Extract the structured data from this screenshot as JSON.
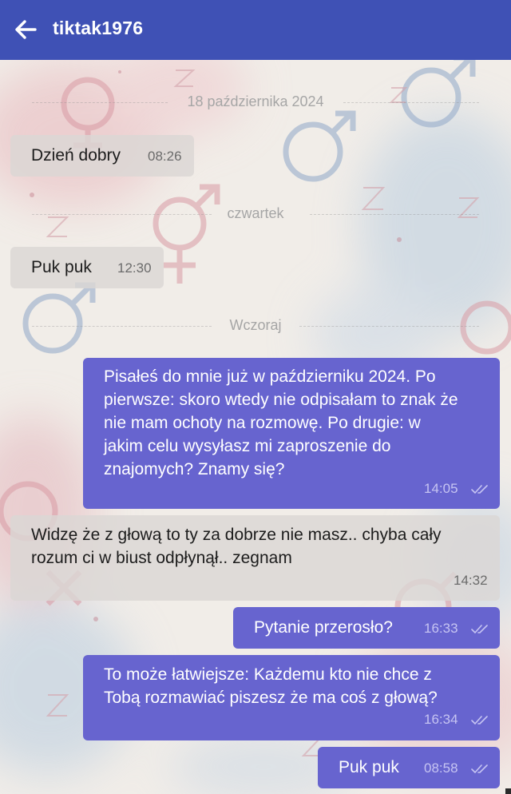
{
  "header": {
    "title": "tiktak1976",
    "back_icon": "arrow-left-icon"
  },
  "colors": {
    "header_bg": "#3f51b5",
    "outgoing_bubble": "#6764cf",
    "incoming_bubble": "#d9d6d3",
    "read_ticks": "#c6c4f2"
  },
  "separators": [
    "18 października 2024",
    "czwartek",
    "Wczoraj"
  ],
  "messages": [
    {
      "direction": "in",
      "text": "Dzień dobry",
      "time": "08:26"
    },
    {
      "direction": "in",
      "text": "Puk puk",
      "time": "12:30"
    },
    {
      "direction": "out",
      "lines": [
        "Pisałeś do mnie już w październiku 2024. Po",
        "pierwsze: skoro wtedy nie odpisałam to znak że",
        "nie mam ochoty na rozmowę. Po drugie: w",
        "jakim celu wysyłasz mi zaproszenie do",
        "znajomych? Znamy się?"
      ],
      "time": "14:05",
      "status_icon": "double-check-icon"
    },
    {
      "direction": "in",
      "lines": [
        "Widzę że z głową to ty za dobrze nie masz.. chyba cały",
        "rozum ci w biust odpłynął.. zegnam"
      ],
      "time": "14:32"
    },
    {
      "direction": "out",
      "text": "Pytanie przerosło?",
      "time": "16:33",
      "status_icon": "double-check-icon"
    },
    {
      "direction": "out",
      "lines": [
        "To może łatwiejsze: Każdemu kto nie chce z",
        "Tobą rozmawiać piszesz że ma coś z głową?"
      ],
      "time": "16:34",
      "status_icon": "double-check-icon"
    },
    {
      "direction": "out",
      "text": "Puk puk",
      "time": "08:58",
      "status_icon": "double-check-icon"
    }
  ]
}
